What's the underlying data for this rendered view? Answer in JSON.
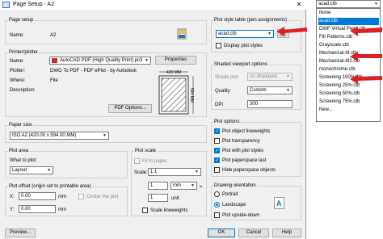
{
  "window": {
    "title": "Page Setup - A2"
  },
  "page_setup": {
    "group_label": "Page setup",
    "name_label": "Name:",
    "name_value": "A2"
  },
  "printer": {
    "group_label": "Printer/plotter",
    "name_label": "Name:",
    "name_value": "AutoCAD PDF (High Quality Print).pc3",
    "properties_button": "Properties",
    "plotter_label": "Plotter:",
    "plotter_value": "DWG To PDF - PDF ePlot - by Autodesk",
    "where_label": "Where:",
    "where_value": "File",
    "description_label": "Description:",
    "pdf_options_button": "PDF Options...",
    "preview_width": "420 MM",
    "preview_height": "594 MM"
  },
  "paper_size": {
    "group_label": "Paper size",
    "value": "ISO A2 (420.00 x 594.00 MM)"
  },
  "plot_area": {
    "group_label": "Plot area",
    "what_label": "What to plot:",
    "what_value": "Layout"
  },
  "plot_offset": {
    "group_label": "Plot offset (origin set to printable area)",
    "x_label": "X:",
    "x_value": "0.00",
    "x_unit": "mm",
    "y_label": "Y:",
    "y_value": "0.00",
    "y_unit": "mm",
    "center_label": "Center the plot"
  },
  "plot_scale": {
    "group_label": "Plot scale",
    "fit_label": "Fit to paper",
    "scale_label": "Scale:",
    "scale_value": "1:1",
    "value1": "1",
    "unit1": "mm",
    "value2": "1",
    "unit2": "unit",
    "lineweights_label": "Scale lineweights"
  },
  "plot_style_table": {
    "group_label": "Plot style table (pen assignments)",
    "value": "acad.ctb",
    "display_label": "Display plot styles"
  },
  "shaded_viewport": {
    "group_label": "Shaded viewport options",
    "shade_label": "Shade plot",
    "shade_value": "As displayed",
    "quality_label": "Quality",
    "quality_value": "Custom",
    "dpi_label": "DPI",
    "dpi_value": "300"
  },
  "plot_options": {
    "group_label": "Plot options",
    "items": [
      "Plot object lineweights",
      "Plot transparency",
      "Plot with plot styles",
      "Plot paperspace last",
      "Hide paperspace objects"
    ]
  },
  "orientation": {
    "group_label": "Drawing orientation",
    "portrait": "Portrait",
    "landscape": "Landscape",
    "upside_down": "Plot upside-down"
  },
  "buttons": {
    "preview": "Preview...",
    "ok": "OK",
    "cancel": "Cancel",
    "help": "Help"
  },
  "dropdown": {
    "selected": "acad.ctb",
    "items": [
      "None",
      "acad.ctb",
      "DWF Virtual Pens.ctb",
      "Fill Patterns.ctb",
      "Grayscale.ctb",
      "Mechanical-M.ctb",
      "Mechanical-M2.ctb",
      "monochrome.ctb",
      "Screening 100%.ctb",
      "Screening 25%.ctb",
      "Screening 50%.ctb",
      "Screening 75%.ctb",
      "New..."
    ]
  },
  "colors": {
    "accent": "#0078d7",
    "annotation_arrow": "#e02020",
    "dialog_bg": "#f0f0f0"
  }
}
